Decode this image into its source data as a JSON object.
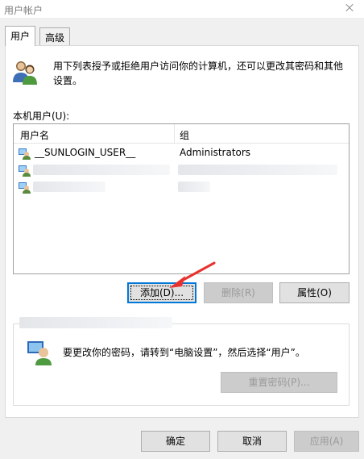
{
  "window": {
    "title": "用户帐户",
    "close_icon": "close-icon"
  },
  "tabs": [
    {
      "label": "用户",
      "active": true
    },
    {
      "label": "高级",
      "active": false
    }
  ],
  "intro": {
    "icon": "users-icon",
    "text": "用下列表授予或拒绝用户访问你的计算机，还可以更改其密码和其他设置。"
  },
  "local_users": {
    "label": "本机用户(U):",
    "columns": [
      "用户名",
      "组"
    ],
    "rows": [
      {
        "name": "__SUNLOGIN_USER__",
        "group": "Administrators",
        "icon": "user-icon",
        "obscured": false
      },
      {
        "name": "",
        "group": "",
        "icon": "user-icon",
        "obscured": true
      },
      {
        "name": "",
        "group": "",
        "icon": "user-icon",
        "obscured": true
      }
    ]
  },
  "buttons": {
    "add": "添加(D)...",
    "remove": "删除(R)",
    "properties": "属性(O)"
  },
  "password": {
    "icon": "user-key-icon",
    "text": "要更改你的密码，请转到“电脑设置”，然后选择“用户”。",
    "reset_button": "重置密码(P)..."
  },
  "dialog_buttons": {
    "ok": "确定",
    "cancel": "取消",
    "apply": "应用(A)"
  },
  "annotation": {
    "arrow_color": "#e8312f"
  }
}
